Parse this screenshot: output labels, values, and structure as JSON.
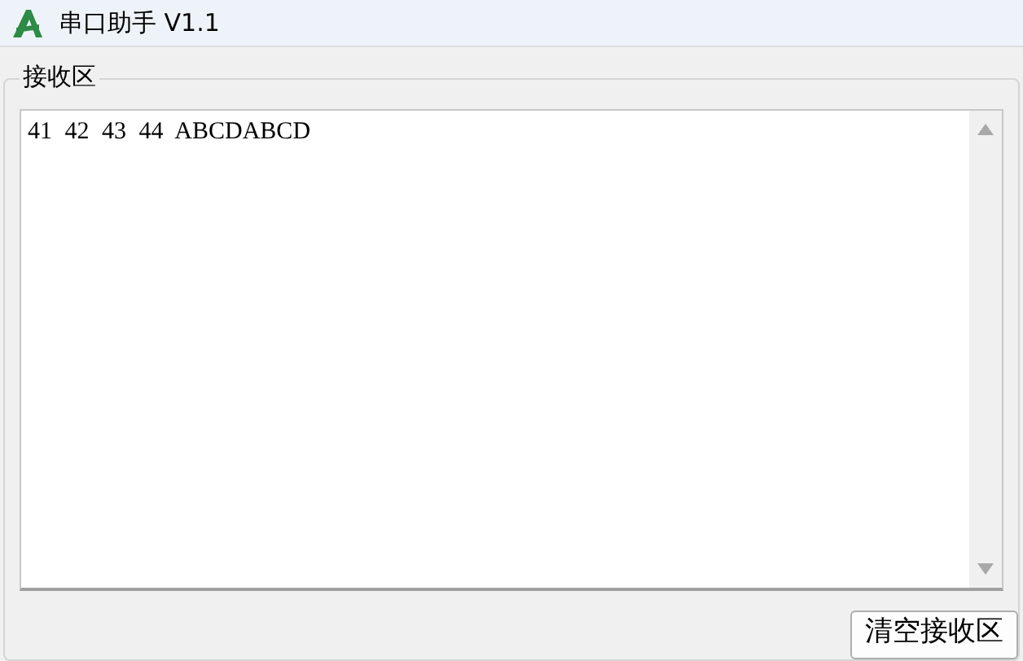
{
  "window": {
    "title": "串口助手 V1.1"
  },
  "receive_group": {
    "label": "接收区",
    "text": "41 42 43 44 ABCDABCD"
  },
  "buttons": [
    {
      "label": "清空接收区"
    }
  ]
}
